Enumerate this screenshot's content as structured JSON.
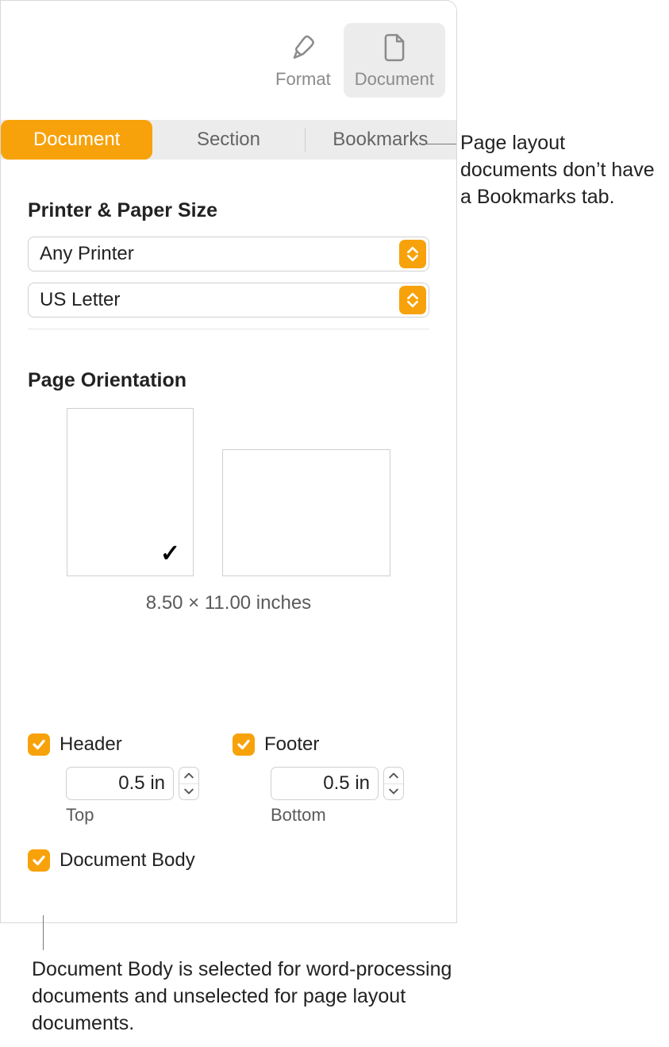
{
  "toolbar": {
    "format_label": "Format",
    "document_label": "Document"
  },
  "tabs": {
    "document": "Document",
    "section": "Section",
    "bookmarks": "Bookmarks"
  },
  "printer_section": {
    "title": "Printer & Paper Size",
    "printer": "Any Printer",
    "paper": "US Letter"
  },
  "orientation_section": {
    "title": "Page Orientation",
    "dimensions": "8.50 × 11.00 inches"
  },
  "header": {
    "label": "Header",
    "value": "0.5 in",
    "pos": "Top"
  },
  "footer": {
    "label": "Footer",
    "value": "0.5 in",
    "pos": "Bottom"
  },
  "docbody": {
    "label": "Document Body"
  },
  "callouts": {
    "bookmarks": "Page layout documents don’t have a Bookmarks tab.",
    "docbody": "Document Body is selected for word-processing documents and unselected for page layout documents."
  }
}
